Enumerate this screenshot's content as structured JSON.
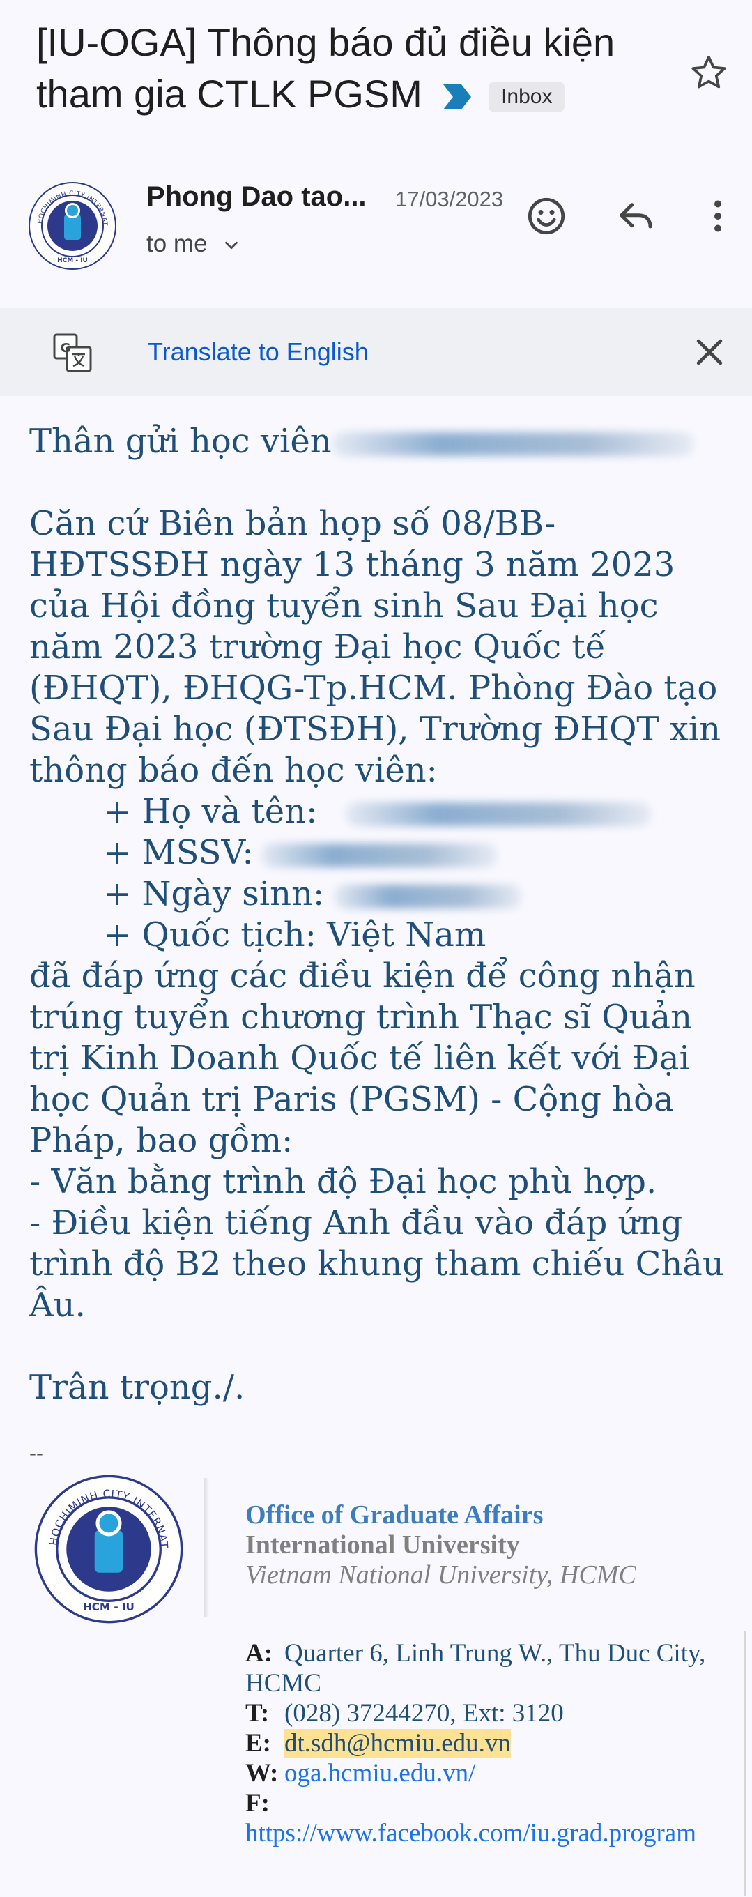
{
  "subject": {
    "title": "[IU-OGA] Thông báo đủ điều kiện tham gia CTLK PGSM",
    "label": "Inbox"
  },
  "sender": {
    "name": "Phong Dao tao...",
    "date": "17/03/2023",
    "recipient": "to me"
  },
  "translate": {
    "link_text": "Translate to English"
  },
  "body": {
    "greeting": "Thân gửi học viên",
    "para1": "Căn cứ Biên bản họp số 08/BB-HĐTSSĐH ngày 13 tháng 3 năm 2023 của Hội đồng tuyển sinh Sau Đại học năm 2023 trường Đại học Quốc tế (ĐHQT), ĐHQG-Tp.HCM. Phòng Đào tạo Sau Đại học (ĐTSĐH), Trường ĐHQT xin thông báo đến học viên:",
    "field_name": "+ Họ và tên:",
    "field_id": "+ MSSV:",
    "field_dob": "+ Ngày sinn:",
    "field_nationality": "+ Quốc tịch: Việt Nam",
    "para2": "đã đáp ứng các điều kiện để công nhận trúng tuyển chương trình Thạc sĩ Quản trị Kinh Doanh Quốc tế liên kết với Đại học Quản trị Paris (PGSM) - Cộng hòa Pháp, bao gồm:",
    "req1": "- Văn bằng trình độ Đại học phù hợp.",
    "req2": "- Điều kiện tiếng Anh đầu vào đáp ứng trình độ B2 theo khung tham chiếu Châu Âu.",
    "closing": "Trân trọng./."
  },
  "signature": {
    "dash": "--",
    "office": "Office of Graduate Affairs",
    "university": "International University",
    "vnu": "Vietnam National University, HCMC",
    "logo_text_top": "HOCHIMINH CITY INTERNATIONAL UNIVERSITY",
    "logo_text_bottom": "HCM - IU",
    "address_key": "A:",
    "address": "Quarter 6, Linh Trung W., Thu Duc City, HCMC",
    "phone_key": "T:",
    "phone": "(028) 37244270, Ext: 3120",
    "email_key": "E:",
    "email": "dt.sdh@hcmiu.edu.vn",
    "web_key": "W:",
    "web": "oga.hcmiu.edu.vn/",
    "fb_key": "F:",
    "fb": "https://www.facebook.com/iu.grad.program"
  },
  "icons": {
    "importance": "importance-marker-icon",
    "star": "star-icon",
    "emoji": "emoji-icon",
    "reply": "reply-icon",
    "more": "more-vert-icon",
    "translate": "translate-icon",
    "close": "close-icon"
  },
  "colors": {
    "body_text": "#1f4e79",
    "link": "#0b57d0",
    "importance": "#1a7fb8",
    "highlight": "#fde293"
  }
}
